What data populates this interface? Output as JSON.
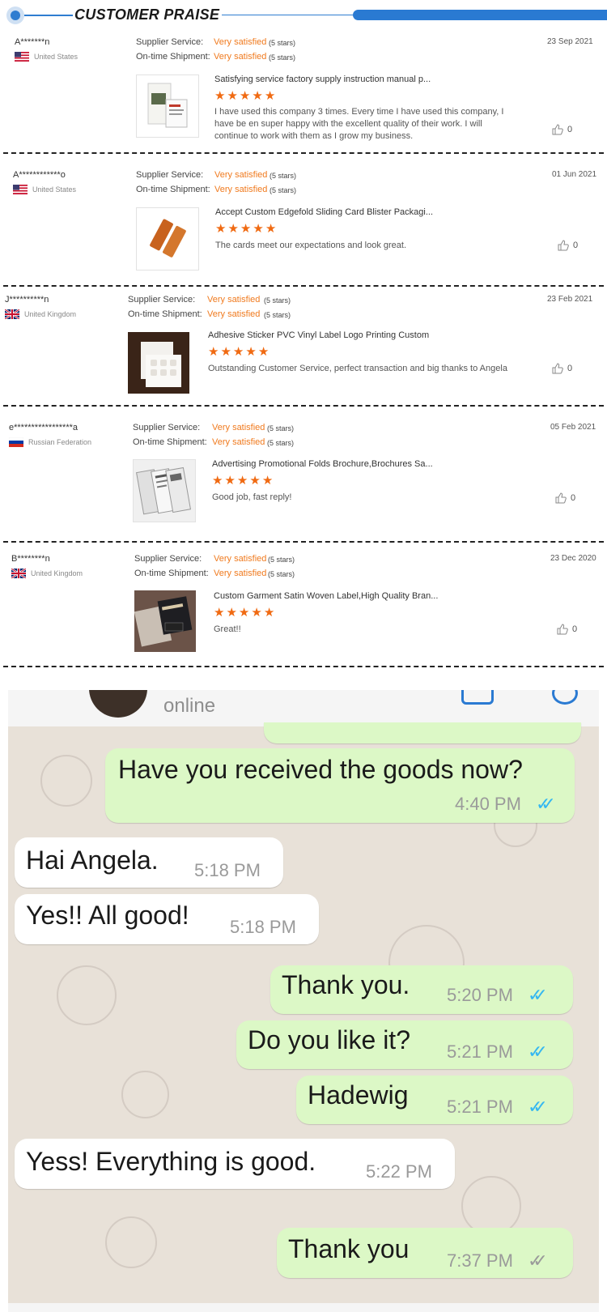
{
  "header": {
    "title": "CUSTOMER PRAISE"
  },
  "labels": {
    "supplier_service": "Supplier Service:",
    "shipment": "On-time Shipment:"
  },
  "reviews": [
    {
      "user": "A*******n",
      "country": "United States",
      "service_rating": "Very satisfied",
      "service_stars": "(5 stars)",
      "shipment_rating": "Very satisfied",
      "shipment_stars": "(5 stars)",
      "date": "23 Sep 2021",
      "product": "Satisfying service factory supply instruction manual p...",
      "stars": 5,
      "comment": "I have used this company 3 times. Every time I have used this company, I have be en super happy with the excellent quality of their work. I will continue to work with them as I grow my business.",
      "likes": "0"
    },
    {
      "user": "A************o",
      "country": "United States",
      "service_rating": "Very satisfied",
      "service_stars": "(5 stars)",
      "shipment_rating": "Very satisfied",
      "shipment_stars": "(5 stars)",
      "date": "01 Jun 2021",
      "product": "Accept Custom Edgefold Sliding Card Blister Packagi...",
      "stars": 5,
      "comment": "The cards meet our expectations and look great.",
      "likes": "0"
    },
    {
      "user": "J**********n",
      "country": "United Kingdom",
      "service_rating": "Very satisfied",
      "service_stars": "(5 stars)",
      "shipment_rating": "Very satisfied",
      "shipment_stars": "(5 stars)",
      "date": "23 Feb 2021",
      "product": "Adhesive Sticker PVC Vinyl Label Logo Printing Custom",
      "stars": 5,
      "comment": "Outstanding Customer Service, perfect transaction and big thanks to Angela",
      "likes": "0"
    },
    {
      "user": "e*****************a",
      "country": "Russian Federation",
      "service_rating": "Very satisfied",
      "service_stars": "(5 stars)",
      "shipment_rating": "Very satisfied",
      "shipment_stars": "(5 stars)",
      "date": "05 Feb 2021",
      "product": "Advertising Promotional Folds Brochure,Brochures Sa...",
      "stars": 5,
      "comment": "Good job, fast reply!",
      "likes": "0"
    },
    {
      "user": "B********n",
      "country": "United Kingdom",
      "service_rating": "Very satisfied",
      "service_stars": "(5 stars)",
      "shipment_rating": "Very satisfied",
      "shipment_stars": "(5 stars)",
      "date": "23 Dec 2020",
      "product": "Custom Garment Satin Woven Label,High Quality Bran...",
      "stars": 5,
      "comment": "Great!!",
      "likes": "0"
    }
  ],
  "chat": {
    "status": "online",
    "messages": [
      {
        "dir": "out",
        "text": "Have you received the goods now?",
        "time": "4:40 PM",
        "ticks": "read"
      },
      {
        "dir": "in",
        "text": "Hai Angela.",
        "time": "5:18 PM"
      },
      {
        "dir": "in",
        "text": "Yes!! All good!",
        "time": "5:18 PM"
      },
      {
        "dir": "out",
        "text": "Thank you.",
        "time": "5:20 PM",
        "ticks": "read"
      },
      {
        "dir": "out",
        "text": "Do you like it?",
        "time": "5:21 PM",
        "ticks": "read"
      },
      {
        "dir": "out",
        "text": "Hadewig",
        "time": "5:21 PM",
        "ticks": "read"
      },
      {
        "dir": "in",
        "text": "Yess! Everything is good.",
        "time": "5:22 PM"
      },
      {
        "dir": "out",
        "text": "Thank you",
        "time": "7:37 PM",
        "ticks": "delivered"
      }
    ]
  },
  "colors": {
    "accent_blue": "#2a7ad2",
    "rating_orange": "#f07a1e",
    "star_orange": "#f06a12",
    "bubble_out": "#dcf8c6",
    "bubble_in": "#ffffff",
    "read_tick": "#34b7f1"
  }
}
